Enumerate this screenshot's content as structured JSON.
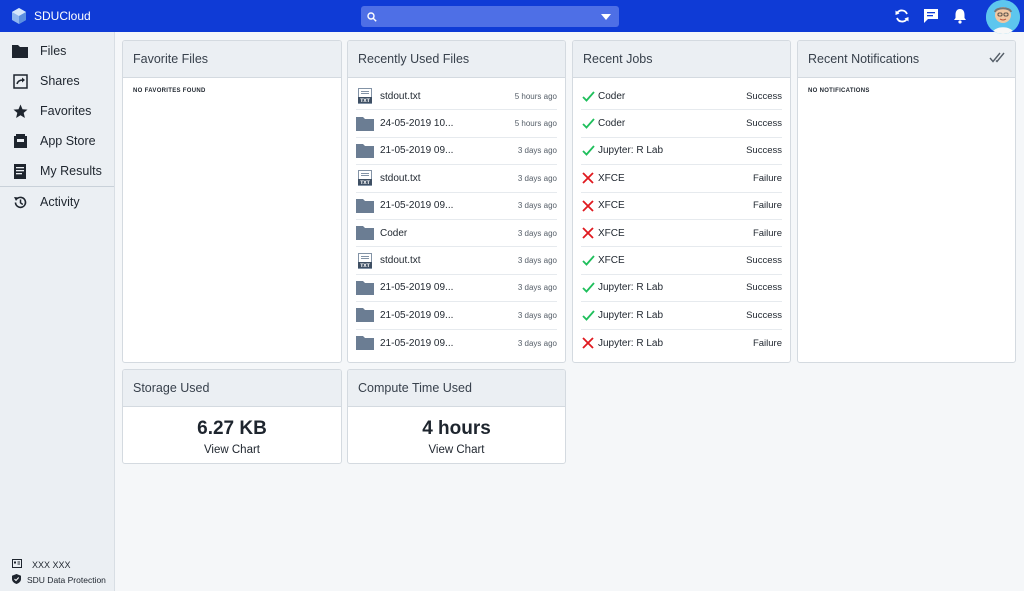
{
  "app": {
    "name": "SDUCloud"
  },
  "search": {
    "placeholder": ""
  },
  "sidebar": {
    "items": [
      {
        "label": "Files",
        "icon": "folder-icon"
      },
      {
        "label": "Shares",
        "icon": "share-icon"
      },
      {
        "label": "Favorites",
        "icon": "star-icon"
      },
      {
        "label": "App Store",
        "icon": "app-store-icon"
      },
      {
        "label": "My Results",
        "icon": "results-icon"
      }
    ],
    "activity": {
      "label": "Activity",
      "icon": "history-icon"
    },
    "footer": {
      "user": "XXX XXX",
      "protection": "SDU Data Protection"
    }
  },
  "cards": {
    "favorites": {
      "title": "Favorite Files",
      "empty": "NO FAVORITES FOUND"
    },
    "recent_files": {
      "title": "Recently Used Files",
      "items": [
        {
          "name": "stdout.txt",
          "type": "txt",
          "time": "5 hours ago"
        },
        {
          "name": "24-05-2019 10...",
          "type": "folder",
          "time": "5 hours ago"
        },
        {
          "name": "21-05-2019 09...",
          "type": "folder",
          "time": "3 days ago"
        },
        {
          "name": "stdout.txt",
          "type": "txt",
          "time": "3 days ago"
        },
        {
          "name": "21-05-2019 09...",
          "type": "folder",
          "time": "3 days ago"
        },
        {
          "name": "Coder",
          "type": "folder",
          "time": "3 days ago"
        },
        {
          "name": "stdout.txt",
          "type": "txt",
          "time": "3 days ago"
        },
        {
          "name": "21-05-2019 09...",
          "type": "folder",
          "time": "3 days ago"
        },
        {
          "name": "21-05-2019 09...",
          "type": "folder",
          "time": "3 days ago"
        },
        {
          "name": "21-05-2019 09...",
          "type": "folder",
          "time": "3 days ago"
        }
      ]
    },
    "recent_jobs": {
      "title": "Recent Jobs",
      "items": [
        {
          "name": "Coder",
          "status": "Success"
        },
        {
          "name": "Coder",
          "status": "Success"
        },
        {
          "name": "Jupyter: R Lab",
          "status": "Success"
        },
        {
          "name": "XFCE",
          "status": "Failure"
        },
        {
          "name": "XFCE",
          "status": "Failure"
        },
        {
          "name": "XFCE",
          "status": "Failure"
        },
        {
          "name": "XFCE",
          "status": "Success"
        },
        {
          "name": "Jupyter: R Lab",
          "status": "Success"
        },
        {
          "name": "Jupyter: R Lab",
          "status": "Success"
        },
        {
          "name": "Jupyter: R Lab",
          "status": "Failure"
        }
      ]
    },
    "notifications": {
      "title": "Recent Notifications",
      "empty": "NO NOTIFICATIONS"
    },
    "storage": {
      "title": "Storage Used",
      "value": "6.27 KB",
      "link": "View Chart"
    },
    "compute": {
      "title": "Compute Time Used",
      "value": "4 hours",
      "link": "View Chart"
    }
  },
  "colors": {
    "topbar": "#0f3bd6",
    "success": "#1fbf5c",
    "failure": "#e0191f",
    "folder": "#6b7d93"
  }
}
